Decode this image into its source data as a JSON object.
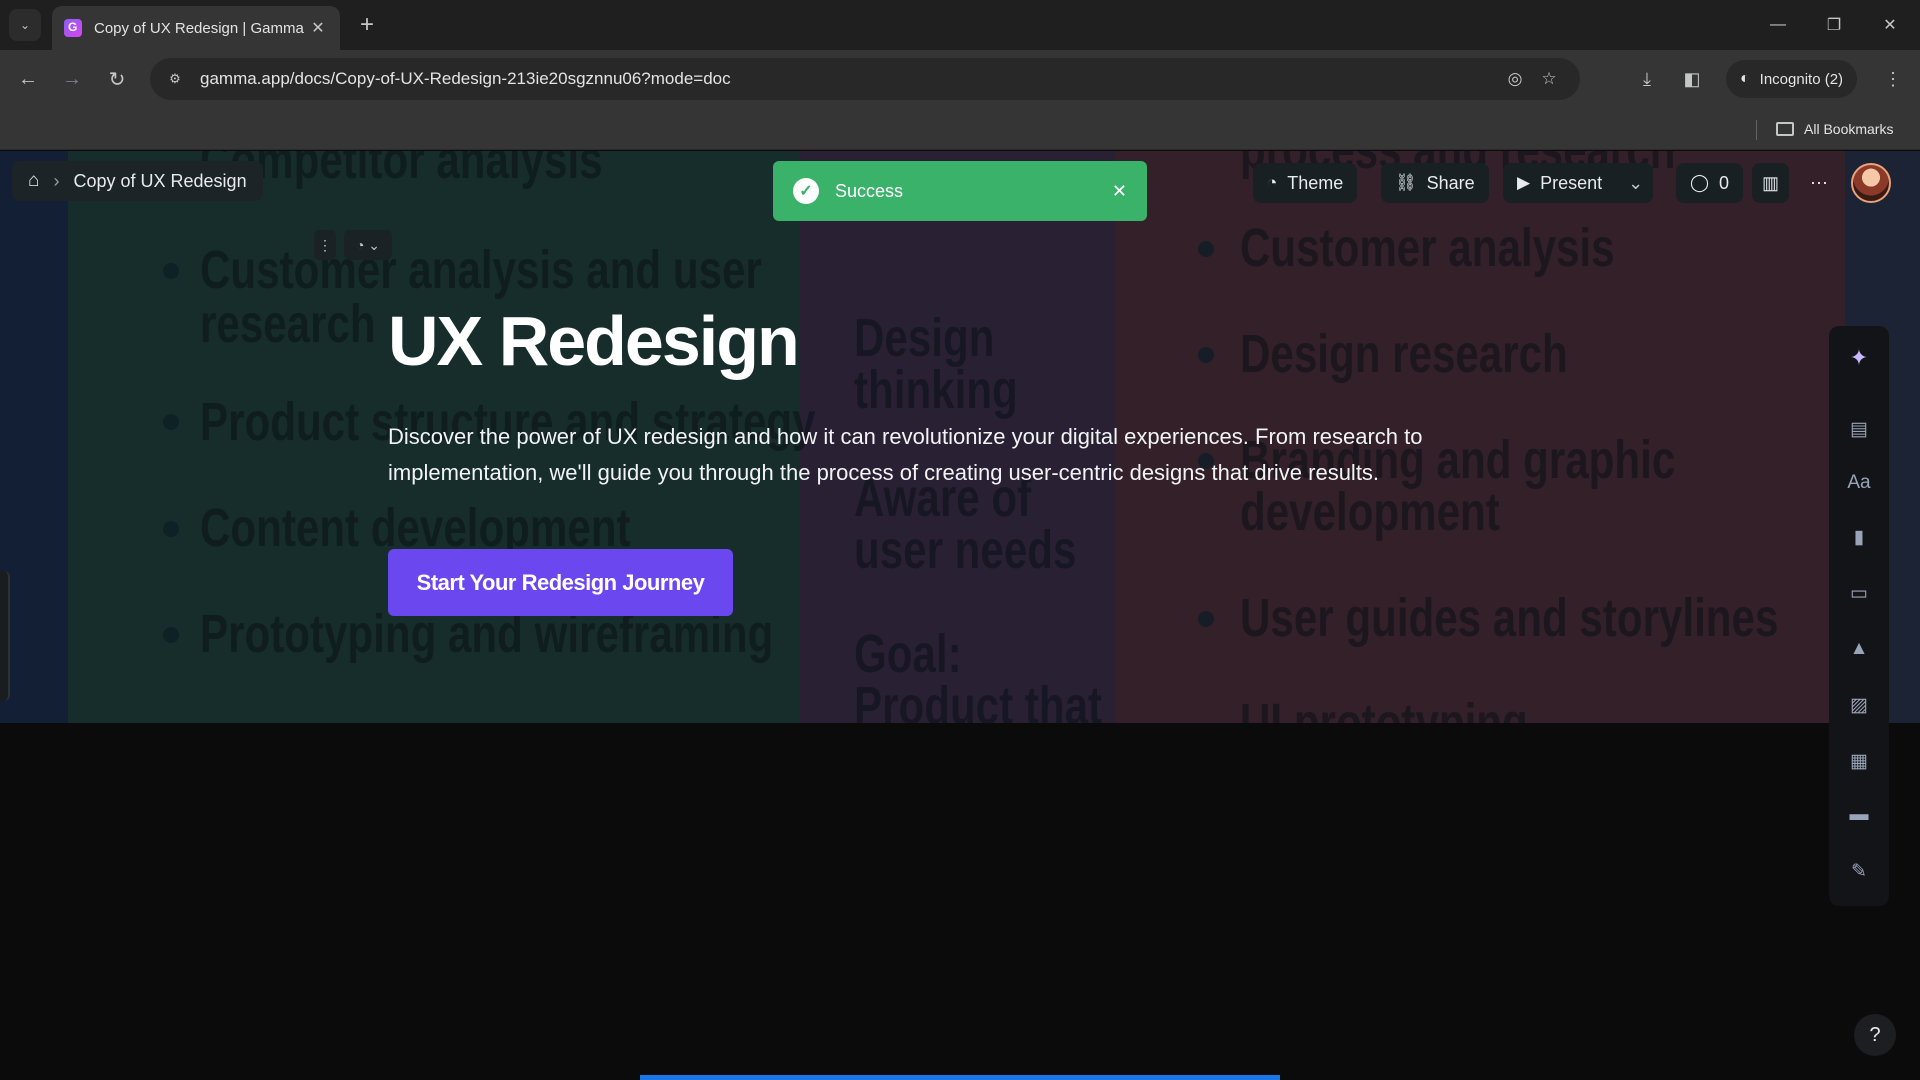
{
  "browser": {
    "tab_title": "Copy of UX Redesign | Gamma",
    "url": "gamma.app/docs/Copy-of-UX-Redesign-213ie20sgznnu06?mode=doc",
    "incognito_label": "Incognito (2)",
    "bookmarks_label": "All Bookmarks"
  },
  "app": {
    "breadcrumb_title": "Copy of UX Redesign",
    "toast_message": "Success",
    "actions": {
      "theme": "Theme",
      "share": "Share",
      "present": "Present",
      "comments_count": "0"
    }
  },
  "background_text": {
    "col1": [
      "Competitor analysis",
      "Customer analysis and user",
      "research",
      "Product structure and strategy",
      "Content development",
      "Prototyping and wireframing"
    ],
    "col2": [
      "Design",
      "thinking",
      "Aware of",
      "user needs",
      "Goal:",
      "Product that"
    ],
    "col3": [
      "process and research",
      "Customer analysis",
      "Design research",
      "Branding and graphic",
      "development",
      "User guides and storylines",
      "UI prototyping"
    ]
  },
  "hero": {
    "title": "UX Redesign",
    "description": "Discover the power of UX redesign and how it can revolutionize your digital experiences. From research to implementation, we'll guide you through the process of creating user-centric designs that drive results.",
    "cta": "Start Your Redesign Journey"
  },
  "sidebar_tools": [
    "ai-icon",
    "card-templates-icon",
    "text-style-icon",
    "callout-icon",
    "layout-icon",
    "shapes-icon",
    "image-icon",
    "table-icon",
    "button-icon",
    "form-icon"
  ],
  "colors": {
    "toast_bg": "#3bb26a",
    "cta_bg": "#6a47ef",
    "accent_progress": "#1b76e8"
  }
}
